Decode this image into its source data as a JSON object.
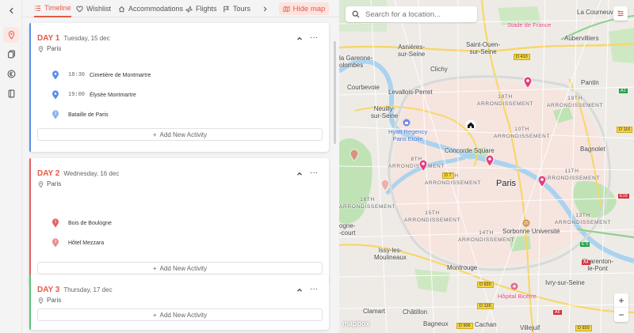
{
  "nav": {
    "tabs": [
      {
        "label": "Timeline",
        "icon": "list-icon",
        "active": true
      },
      {
        "label": "Wishlist",
        "icon": "heart-icon"
      },
      {
        "label": "Accommodations",
        "icon": "home-icon"
      },
      {
        "label": "Flights",
        "icon": "plane-icon"
      },
      {
        "label": "Tours",
        "icon": "flag-icon"
      }
    ],
    "hide_map_label": "Hide map"
  },
  "colors": {
    "accent": "#e55a45",
    "day1": "#5a8fe8",
    "day2": "#e86060",
    "day3": "#5ec27a",
    "poi": "#e53f7d"
  },
  "days": [
    {
      "label": "DAY 1",
      "date": "Tuesday, 15 dec",
      "city": "Paris",
      "activities": [
        {
          "time": "18:30",
          "name": "Cimetière de Montmartre",
          "index": ""
        },
        {
          "time": "19:00",
          "name": "Élysée Montmartre",
          "index": ""
        },
        {
          "time": "",
          "name": "Bataille de Paris",
          "index": "3"
        }
      ],
      "add_label": "Add New Activity"
    },
    {
      "label": "DAY 2",
      "date": "Wednesday, 16 dec",
      "city": "Paris",
      "activities": [
        {
          "time": "",
          "name": "Bois de Boulogne",
          "index": "1"
        },
        {
          "time": "",
          "name": "Hôtel Mezzara",
          "index": "2"
        }
      ],
      "add_label": "Add New Activity"
    },
    {
      "label": "DAY 3",
      "date": "Thursday, 17 dec",
      "city": "Paris",
      "activities": [],
      "add_label": "Add New Activity"
    }
  ],
  "map": {
    "search_placeholder": "Search for a location...",
    "attribution": "mapbox",
    "zoom_in": "+",
    "zoom_out": "−",
    "places": {
      "la_courneuve": "La Courneuve",
      "stade_de_france": "Stade de France",
      "aubervilliers": "Aubervilliers",
      "asnieres": "Asnières-\nsur-Seine",
      "saint_ouen": "Saint-Ouen-\nsur-Seine",
      "colombes": "olombes",
      "garenne": "la Garenne-",
      "clichy": "Clichy",
      "pantin": "Pantin",
      "courbevoie": "Courbevoie",
      "levallois": "Levallois-Perret",
      "neuilly": "Neuilly-\nsur-Seine",
      "arr18": "18TH\nARRONDISSEMENT",
      "arr19": "19TH\nARRONDISSEMENT",
      "arr10": "10TH\nARRONDISSEMENT",
      "hyatt": "Hyatt Regency\nParis Etoile",
      "concorde": "Concorde Square",
      "bagnolet": "Bagnolet",
      "arr8": "8TH\nARRONDISSEMENT",
      "arr11": "11TH\nARRONDISSEMENT",
      "arr7": "7TH\nARRONDISSEMENT",
      "paris": "Paris",
      "arr16": "16TH\nARRONDISSEMENT",
      "arr15": "15TH\nARRONDISSEMENT",
      "arr13": "13TH\nARRONDISSEMENT",
      "arr14": "14TH\nARRONDISSEMENT",
      "sorbonne": "Sorbonne Université",
      "boulogne": "ogne-\n-court",
      "issy": "Issy-les-\nMoulineaux",
      "montrouge": "Montrouge",
      "charenton": "Charenton-\nle-Pont",
      "ivry": "Ivry-sur-Seine",
      "bicetre": "Hôpital Bicêtre",
      "clamart": "Clamart",
      "chatillon": "Châtillon",
      "bagneux": "Bagneux",
      "cachan": "Cachan",
      "villejuif": "Villejuif"
    },
    "roads": {
      "d410": "D 410",
      "a1": "A1",
      "d116": "D 116",
      "e15": "E15",
      "d920": "D 920",
      "d126": "D 126",
      "e5": "E 5",
      "a6": "A6",
      "d906": "D 906",
      "d920b": "D 920",
      "d7": "D 7",
      "a4": "A4"
    }
  }
}
